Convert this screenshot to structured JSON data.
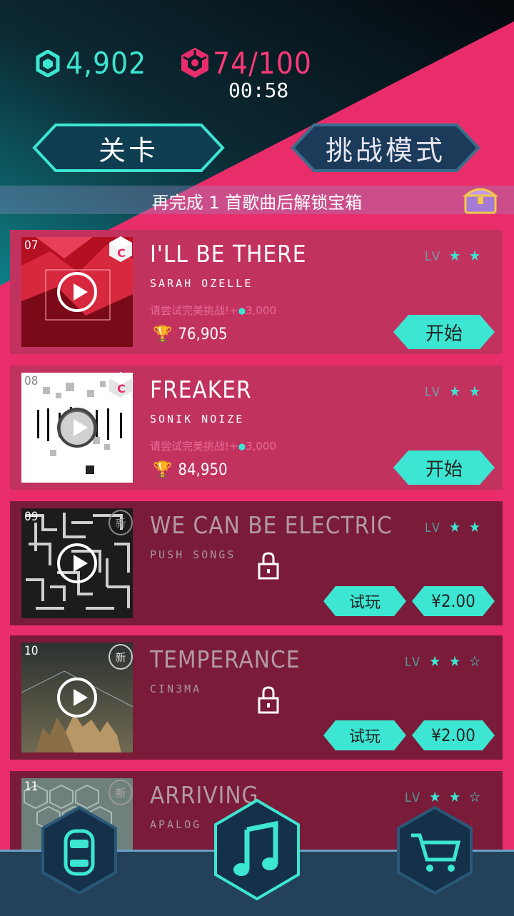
{
  "header": {
    "coins": "4,902",
    "energy": "74/100",
    "timer": "00:58"
  },
  "mode_buttons": {
    "levels": "关卡",
    "challenge": "挑战模式"
  },
  "banner": {
    "text": "再完成 1 首歌曲后解锁宝箱",
    "icon": "treasure-chest-icon"
  },
  "songs": [
    {
      "number": "07",
      "title": "I'LL BE THERE",
      "artist": "SARAH OZELLE",
      "challenge": "请尝试完美挑战!+",
      "challenge_reward": "3,000",
      "score": "76,905",
      "lv_label": "LV",
      "difficulty": 2,
      "max_difficulty": 2,
      "action": "开始",
      "locked": false,
      "badge": "C"
    },
    {
      "number": "08",
      "title": "FREAKER",
      "artist": "SONIK NOIZE",
      "challenge": "请尝试完美挑战!+",
      "challenge_reward": "3,000",
      "score": "84,950",
      "lv_label": "LV",
      "difficulty": 2,
      "max_difficulty": 2,
      "action": "开始",
      "locked": false,
      "badge": "C"
    },
    {
      "number": "09",
      "title": "WE CAN BE ELECTRIC",
      "artist": "PUSH SONGS",
      "lv_label": "LV",
      "difficulty": 2,
      "max_difficulty": 2,
      "trial": "试玩",
      "price": "¥2.00",
      "locked": true,
      "badge": "新"
    },
    {
      "number": "10",
      "title": "TEMPERANCE",
      "artist": "CIN3MA",
      "lv_label": "LV",
      "difficulty": 2,
      "max_difficulty": 3,
      "trial": "试玩",
      "price": "¥2.00",
      "locked": true,
      "badge": "新"
    },
    {
      "number": "11",
      "title": "ARRIVING",
      "artist": "APALOG",
      "lv_label": "LV",
      "difficulty": 2,
      "max_difficulty": 3,
      "locked": true,
      "badge": "新"
    }
  ],
  "nav": [
    "car-icon",
    "music-note-icon",
    "shopping-cart-icon"
  ],
  "colors": {
    "accent": "#3ce6d2",
    "pink": "#e92d6b",
    "card_open": "#c2325f",
    "card_locked": "#7a1b39",
    "nav": "#24415a"
  }
}
